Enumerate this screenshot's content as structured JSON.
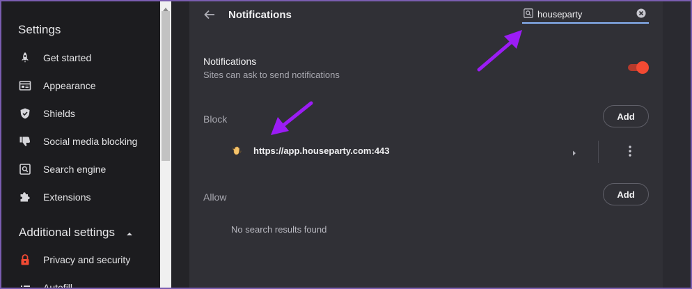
{
  "sidebar": {
    "title": "Settings",
    "items": [
      {
        "label": "Get started",
        "icon": "rocket-icon"
      },
      {
        "label": "Appearance",
        "icon": "appearance-icon"
      },
      {
        "label": "Shields",
        "icon": "shield-icon"
      },
      {
        "label": "Social media blocking",
        "icon": "thumbs-down-icon"
      },
      {
        "label": "Search engine",
        "icon": "search-icon"
      },
      {
        "label": "Extensions",
        "icon": "puzzle-icon"
      }
    ],
    "additional_section": {
      "label": "Additional settings",
      "expanded": true
    },
    "additional_items": [
      {
        "label": "Privacy and security",
        "icon": "lock-icon",
        "icon_color": "#f24a33"
      },
      {
        "label": "Autofill",
        "icon": "autofill-icon"
      }
    ]
  },
  "header": {
    "title": "Notifications",
    "search": {
      "value": "houseparty",
      "placeholder": ""
    }
  },
  "notifications": {
    "title": "Notifications",
    "description": "Sites can ask to send notifications",
    "enabled": true
  },
  "block": {
    "label": "Block",
    "add_label": "Add",
    "sites": [
      {
        "url": "https://app.houseparty.com:443",
        "icon": "waving-hand-icon"
      }
    ]
  },
  "allow": {
    "label": "Allow",
    "add_label": "Add",
    "empty_message": "No search results found"
  },
  "annotations": {
    "arrow_color": "#9b1cf5"
  },
  "colors": {
    "sidebar_bg": "#1c1c1f",
    "main_bg": "#303036",
    "toggle_on": "#f24a33",
    "search_underline": "#8ab4f8"
  }
}
